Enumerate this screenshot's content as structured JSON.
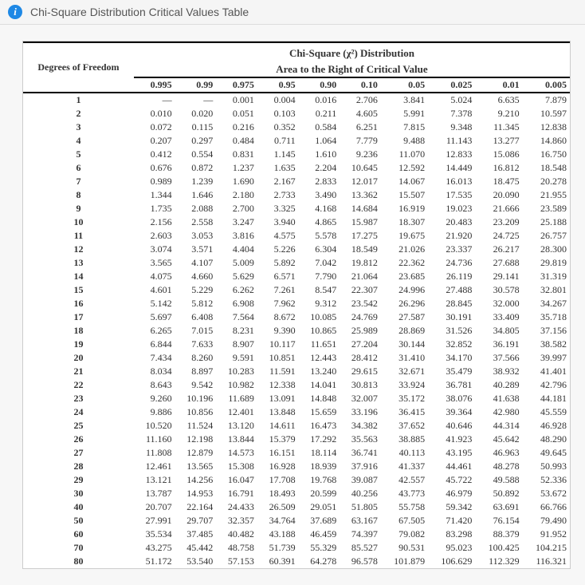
{
  "header": {
    "info_icon": "i",
    "title": "Chi-Square Distribution Critical Values Table"
  },
  "table": {
    "title_line1": "Chi-Square (χ²) Distribution",
    "title_line2": "Area to the Right of Critical Value",
    "dof_header": "Degrees of Freedom",
    "alphas": [
      "0.995",
      "0.99",
      "0.975",
      "0.95",
      "0.90",
      "0.10",
      "0.05",
      "0.025",
      "0.01",
      "0.005"
    ]
  },
  "chart_data": {
    "type": "table",
    "title": "Chi-Square (χ²) Distribution – Area to the Right of Critical Value",
    "columns": [
      "df",
      "0.995",
      "0.99",
      "0.975",
      "0.95",
      "0.90",
      "0.10",
      "0.05",
      "0.025",
      "0.01",
      "0.005"
    ],
    "rows": [
      [
        "1",
        "—",
        "—",
        "0.001",
        "0.004",
        "0.016",
        "2.706",
        "3.841",
        "5.024",
        "6.635",
        "7.879"
      ],
      [
        "2",
        "0.010",
        "0.020",
        "0.051",
        "0.103",
        "0.211",
        "4.605",
        "5.991",
        "7.378",
        "9.210",
        "10.597"
      ],
      [
        "3",
        "0.072",
        "0.115",
        "0.216",
        "0.352",
        "0.584",
        "6.251",
        "7.815",
        "9.348",
        "11.345",
        "12.838"
      ],
      [
        "4",
        "0.207",
        "0.297",
        "0.484",
        "0.711",
        "1.064",
        "7.779",
        "9.488",
        "11.143",
        "13.277",
        "14.860"
      ],
      [
        "5",
        "0.412",
        "0.554",
        "0.831",
        "1.145",
        "1.610",
        "9.236",
        "11.070",
        "12.833",
        "15.086",
        "16.750"
      ],
      [
        "6",
        "0.676",
        "0.872",
        "1.237",
        "1.635",
        "2.204",
        "10.645",
        "12.592",
        "14.449",
        "16.812",
        "18.548"
      ],
      [
        "7",
        "0.989",
        "1.239",
        "1.690",
        "2.167",
        "2.833",
        "12.017",
        "14.067",
        "16.013",
        "18.475",
        "20.278"
      ],
      [
        "8",
        "1.344",
        "1.646",
        "2.180",
        "2.733",
        "3.490",
        "13.362",
        "15.507",
        "17.535",
        "20.090",
        "21.955"
      ],
      [
        "9",
        "1.735",
        "2.088",
        "2.700",
        "3.325",
        "4.168",
        "14.684",
        "16.919",
        "19.023",
        "21.666",
        "23.589"
      ],
      [
        "10",
        "2.156",
        "2.558",
        "3.247",
        "3.940",
        "4.865",
        "15.987",
        "18.307",
        "20.483",
        "23.209",
        "25.188"
      ],
      [
        "11",
        "2.603",
        "3.053",
        "3.816",
        "4.575",
        "5.578",
        "17.275",
        "19.675",
        "21.920",
        "24.725",
        "26.757"
      ],
      [
        "12",
        "3.074",
        "3.571",
        "4.404",
        "5.226",
        "6.304",
        "18.549",
        "21.026",
        "23.337",
        "26.217",
        "28.300"
      ],
      [
        "13",
        "3.565",
        "4.107",
        "5.009",
        "5.892",
        "7.042",
        "19.812",
        "22.362",
        "24.736",
        "27.688",
        "29.819"
      ],
      [
        "14",
        "4.075",
        "4.660",
        "5.629",
        "6.571",
        "7.790",
        "21.064",
        "23.685",
        "26.119",
        "29.141",
        "31.319"
      ],
      [
        "15",
        "4.601",
        "5.229",
        "6.262",
        "7.261",
        "8.547",
        "22.307",
        "24.996",
        "27.488",
        "30.578",
        "32.801"
      ],
      [
        "16",
        "5.142",
        "5.812",
        "6.908",
        "7.962",
        "9.312",
        "23.542",
        "26.296",
        "28.845",
        "32.000",
        "34.267"
      ],
      [
        "17",
        "5.697",
        "6.408",
        "7.564",
        "8.672",
        "10.085",
        "24.769",
        "27.587",
        "30.191",
        "33.409",
        "35.718"
      ],
      [
        "18",
        "6.265",
        "7.015",
        "8.231",
        "9.390",
        "10.865",
        "25.989",
        "28.869",
        "31.526",
        "34.805",
        "37.156"
      ],
      [
        "19",
        "6.844",
        "7.633",
        "8.907",
        "10.117",
        "11.651",
        "27.204",
        "30.144",
        "32.852",
        "36.191",
        "38.582"
      ],
      [
        "20",
        "7.434",
        "8.260",
        "9.591",
        "10.851",
        "12.443",
        "28.412",
        "31.410",
        "34.170",
        "37.566",
        "39.997"
      ],
      [
        "21",
        "8.034",
        "8.897",
        "10.283",
        "11.591",
        "13.240",
        "29.615",
        "32.671",
        "35.479",
        "38.932",
        "41.401"
      ],
      [
        "22",
        "8.643",
        "9.542",
        "10.982",
        "12.338",
        "14.041",
        "30.813",
        "33.924",
        "36.781",
        "40.289",
        "42.796"
      ],
      [
        "23",
        "9.260",
        "10.196",
        "11.689",
        "13.091",
        "14.848",
        "32.007",
        "35.172",
        "38.076",
        "41.638",
        "44.181"
      ],
      [
        "24",
        "9.886",
        "10.856",
        "12.401",
        "13.848",
        "15.659",
        "33.196",
        "36.415",
        "39.364",
        "42.980",
        "45.559"
      ],
      [
        "25",
        "10.520",
        "11.524",
        "13.120",
        "14.611",
        "16.473",
        "34.382",
        "37.652",
        "40.646",
        "44.314",
        "46.928"
      ],
      [
        "26",
        "11.160",
        "12.198",
        "13.844",
        "15.379",
        "17.292",
        "35.563",
        "38.885",
        "41.923",
        "45.642",
        "48.290"
      ],
      [
        "27",
        "11.808",
        "12.879",
        "14.573",
        "16.151",
        "18.114",
        "36.741",
        "40.113",
        "43.195",
        "46.963",
        "49.645"
      ],
      [
        "28",
        "12.461",
        "13.565",
        "15.308",
        "16.928",
        "18.939",
        "37.916",
        "41.337",
        "44.461",
        "48.278",
        "50.993"
      ],
      [
        "29",
        "13.121",
        "14.256",
        "16.047",
        "17.708",
        "19.768",
        "39.087",
        "42.557",
        "45.722",
        "49.588",
        "52.336"
      ],
      [
        "30",
        "13.787",
        "14.953",
        "16.791",
        "18.493",
        "20.599",
        "40.256",
        "43.773",
        "46.979",
        "50.892",
        "53.672"
      ],
      [
        "40",
        "20.707",
        "22.164",
        "24.433",
        "26.509",
        "29.051",
        "51.805",
        "55.758",
        "59.342",
        "63.691",
        "66.766"
      ],
      [
        "50",
        "27.991",
        "29.707",
        "32.357",
        "34.764",
        "37.689",
        "63.167",
        "67.505",
        "71.420",
        "76.154",
        "79.490"
      ],
      [
        "60",
        "35.534",
        "37.485",
        "40.482",
        "43.188",
        "46.459",
        "74.397",
        "79.082",
        "83.298",
        "88.379",
        "91.952"
      ],
      [
        "70",
        "43.275",
        "45.442",
        "48.758",
        "51.739",
        "55.329",
        "85.527",
        "90.531",
        "95.023",
        "100.425",
        "104.215"
      ],
      [
        "80",
        "51.172",
        "53.540",
        "57.153",
        "60.391",
        "64.278",
        "96.578",
        "101.879",
        "106.629",
        "112.329",
        "116.321"
      ]
    ],
    "group_breaks_after_index": [
      4,
      9,
      14,
      19,
      24,
      29
    ]
  }
}
